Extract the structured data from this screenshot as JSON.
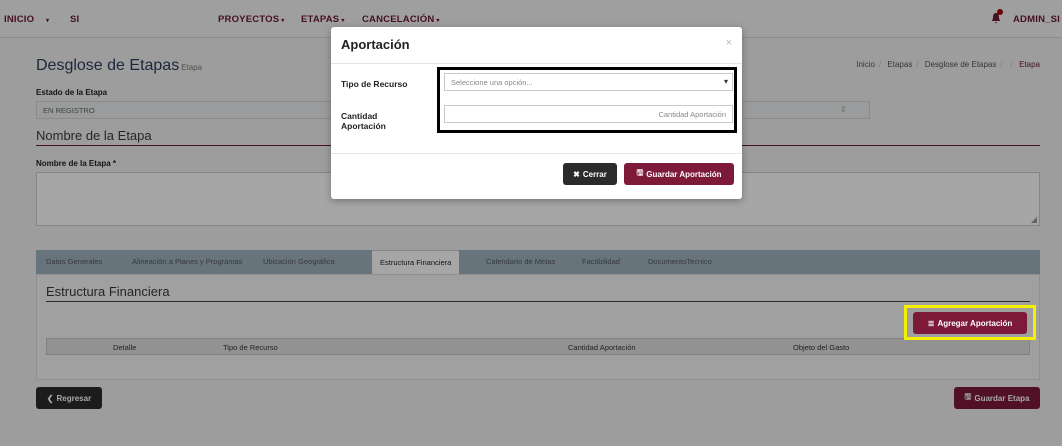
{
  "topbar": {
    "inicio": "INICIO",
    "si": "SI",
    "proyectos": "PROYECTOS",
    "etapas": "ETAPAS",
    "cancelacion": "CANCELACIÓN",
    "user": "ADMIN_SI",
    "caret": "▾"
  },
  "page": {
    "title": "Desglose de Etapas",
    "title_small": "Etapa",
    "breadcrumb": [
      "Inicio",
      "Etapas",
      "Desglose de Etapas",
      "Etapa"
    ],
    "estado_label": "Estado de la Etapa",
    "estado_value": "EN REGISTRO",
    "section_nombre": "Nombre de la Etapa",
    "nombre_label": "Nombre de la Etapa *"
  },
  "tabs": [
    "Datos Generales",
    "Alineación a Planes y Programas",
    "Ubicación Geográfica",
    "Estructura Financiera",
    "Calendario de Metas",
    "Factibilidad",
    "DocumentoTecnico"
  ],
  "estructura": {
    "title": "Estructura Financiera",
    "add_button": "Agregar Aportación",
    "columns": [
      "Detalle",
      "Tipo de Recurso",
      "Cantidad Aportación",
      "Objeto del Gasto"
    ]
  },
  "footer": {
    "back_button": "Regresar",
    "save_button": "Guardar Etapa"
  },
  "modal": {
    "title": "Aportación",
    "close": "×",
    "tipo_label": "Tipo de Recurso",
    "tipo_placeholder": "Seleccione una opción...",
    "cantidad_label_1": "Cantidad",
    "cantidad_label_2": "Aportación",
    "cantidad_placeholder": "Cantidad Aportación",
    "cerrar_button": "Cerrar",
    "guardar_button": "Guardar Aportación"
  },
  "colors": {
    "brand": "#7d1a3a",
    "highlight_yellow": "#f4f000"
  }
}
